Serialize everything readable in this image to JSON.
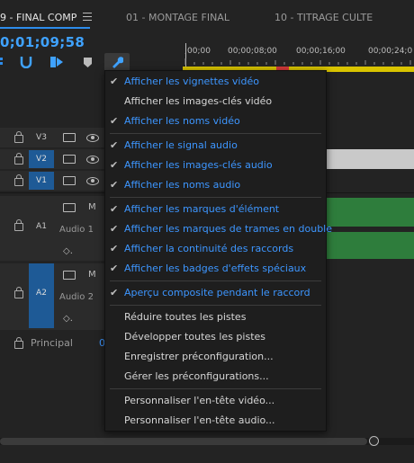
{
  "tabs": [
    {
      "label": "9 - FINAL COMP"
    },
    {
      "label": "01 - MONTAGE FINAL"
    },
    {
      "label": "10 - TITRAGE CULTE"
    }
  ],
  "timecode": "0;01;09;58",
  "ruler": {
    "ticks": [
      ";00;00",
      "00;00;08;00",
      "00;00;16;00",
      "00;00;24;0"
    ]
  },
  "video_tracks": [
    {
      "label": "V3",
      "active": false
    },
    {
      "label": "V2",
      "active": true
    },
    {
      "label": "V1",
      "active": true
    }
  ],
  "audio_tracks": [
    {
      "label": "A1",
      "name": "Audio 1",
      "mute": "M"
    },
    {
      "label": "A2",
      "name": "Audio 2",
      "mute": "M"
    }
  ],
  "master": {
    "label": "Principal",
    "value": "0"
  },
  "colors": {
    "accent": "#3d96ff",
    "clip_audio": "#2e7d3c",
    "clip_video": "#c9c9c9"
  },
  "menu": {
    "items": [
      {
        "label": "Afficher les vignettes vidéo",
        "checked": true
      },
      {
        "label": "Afficher les images-clés vidéo",
        "checked": false
      },
      {
        "label": "Afficher les noms vidéo",
        "checked": true
      },
      {
        "label": "Afficher le signal audio",
        "checked": true
      },
      {
        "label": "Afficher les images-clés audio",
        "checked": true
      },
      {
        "label": "Afficher les noms audio",
        "checked": true
      },
      {
        "label": "Afficher les marques d'élément",
        "checked": true
      },
      {
        "label": "Afficher les marques de trames en double",
        "checked": true
      },
      {
        "label": "Afficher la continuité des raccords",
        "checked": true
      },
      {
        "label": "Afficher les badges d'effets spéciaux",
        "checked": true
      },
      {
        "label": "Aperçu composite pendant le raccord",
        "checked": true
      },
      {
        "label": "Réduire toutes les pistes",
        "checked": false
      },
      {
        "label": "Développer toutes les pistes",
        "checked": false
      },
      {
        "label": "Enregistrer préconfiguration...",
        "checked": false
      },
      {
        "label": "Gérer les préconfigurations...",
        "checked": false
      },
      {
        "label": "Personnaliser l'en-tête vidéo...",
        "checked": false
      },
      {
        "label": "Personnaliser l'en-tête audio...",
        "checked": false
      }
    ]
  }
}
